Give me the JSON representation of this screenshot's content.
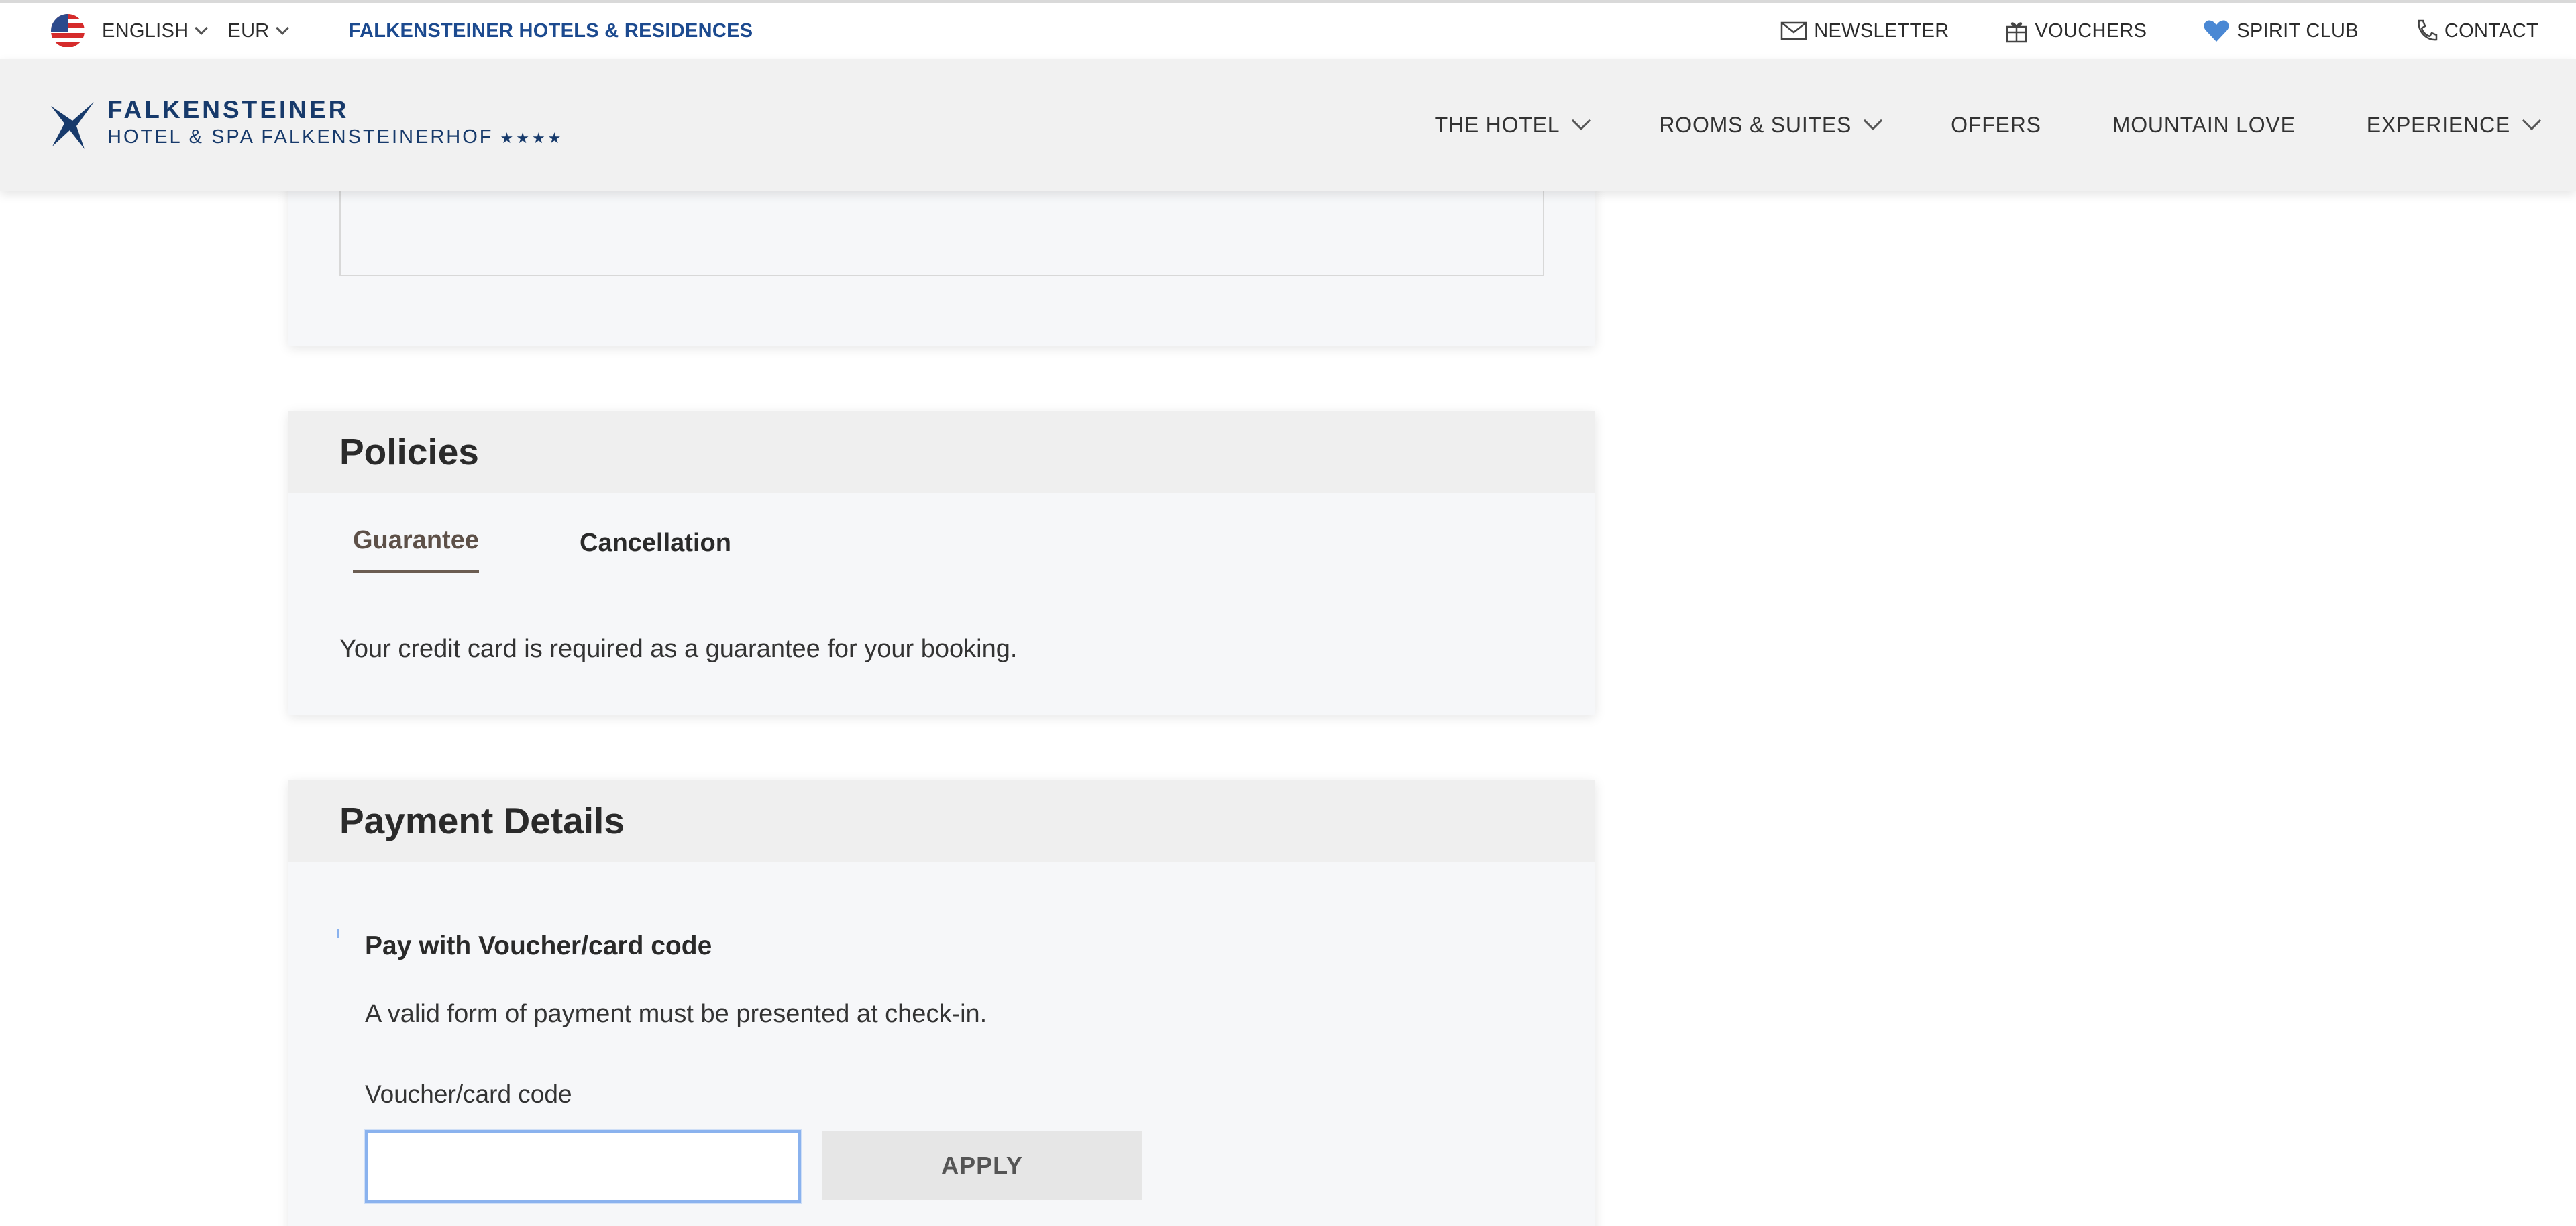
{
  "topbar": {
    "language": "ENGLISH",
    "currency": "EUR",
    "brand_link": "FALKENSTEINER HOTELS & RESIDENCES",
    "newsletter": "NEWSLETTER",
    "vouchers": "VOUCHERS",
    "spirit_club": "SPIRIT CLUB",
    "contact": "CONTACT"
  },
  "header": {
    "logo_line1": "FALKENSTEINER",
    "logo_line2": "HOTEL & SPA FALKENSTEINERHOF",
    "logo_stars": "★★★★",
    "nav": {
      "the_hotel": "THE HOTEL",
      "rooms_suites": "ROOMS & SUITES",
      "offers": "OFFERS",
      "mountain_love": "MOUNTAIN LOVE",
      "experience": "EXPERIENCE"
    }
  },
  "policies": {
    "title": "Policies",
    "tabs": [
      "Guarantee",
      "Cancellation"
    ],
    "active_tab_text": "Your credit card is required as a guarantee for your booking."
  },
  "payment": {
    "title": "Payment Details",
    "option_title": "Pay with Voucher/card code",
    "note": "A valid form of payment must be presented at check-in.",
    "voucher_label": "Voucher/card code",
    "voucher_value": "",
    "apply_label": "APPLY"
  },
  "colors": {
    "brand_blue": "#1c4a8f",
    "logo_navy": "#173a6b",
    "active_tab": "#6b5d52",
    "focus_blue": "#8ab2ee"
  }
}
